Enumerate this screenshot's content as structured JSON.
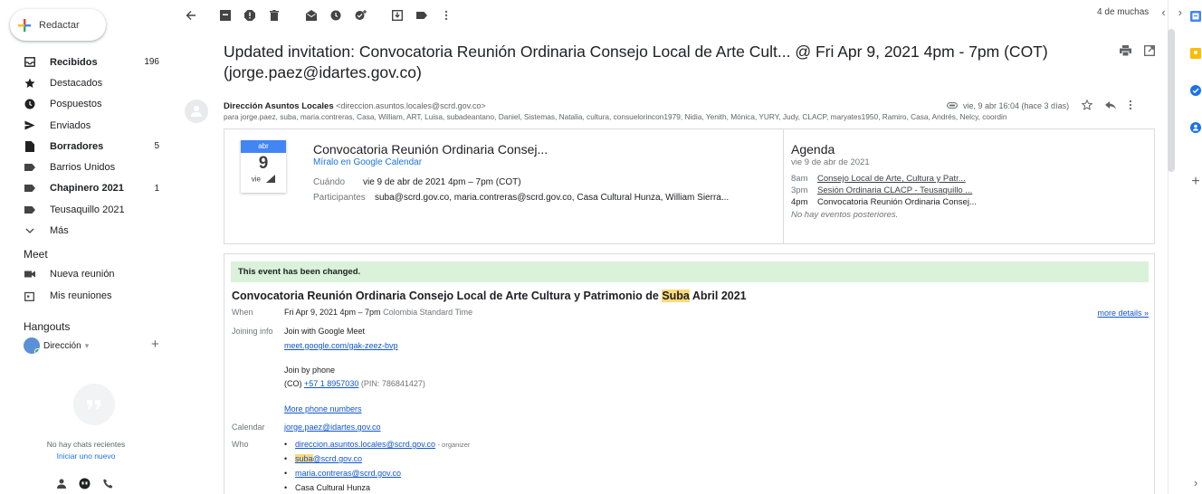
{
  "compose": {
    "label": "Redactar"
  },
  "nav": [
    {
      "label": "Recibidos",
      "count": "196",
      "bold": true,
      "icon": "inbox-icon"
    },
    {
      "label": "Destacados",
      "count": "",
      "bold": false,
      "icon": "star-icon"
    },
    {
      "label": "Pospuestos",
      "count": "",
      "bold": false,
      "icon": "clock-icon"
    },
    {
      "label": "Enviados",
      "count": "",
      "bold": false,
      "icon": "send-icon"
    },
    {
      "label": "Borradores",
      "count": "5",
      "bold": true,
      "icon": "draft-icon"
    },
    {
      "label": "Barrios Unidos",
      "count": "",
      "bold": false,
      "icon": "label-icon"
    },
    {
      "label": "Chapinero 2021",
      "count": "1",
      "bold": true,
      "icon": "label-icon"
    },
    {
      "label": "Teusaquillo 2021",
      "count": "",
      "bold": false,
      "icon": "label-icon"
    },
    {
      "label": "Más",
      "count": "",
      "bold": false,
      "icon": "chevron-down-icon"
    }
  ],
  "meet": {
    "title": "Meet",
    "new_meeting": "Nueva reunión",
    "my_meetings": "Mis reuniones"
  },
  "hangouts": {
    "title": "Hangouts",
    "user": "Dirección",
    "empty": "No hay chats recientes",
    "start": "Iniciar uno nuevo"
  },
  "pager": {
    "text": "4 de muchas"
  },
  "email": {
    "subject": "Updated invitation: Convocatoria Reunión Ordinaria Consejo Local de Arte Cult... @ Fri Apr 9, 2021 4pm - 7pm (COT) (jorge.paez@idartes.gov.co)",
    "sender_name": "Dirección Asuntos Locales",
    "sender_email": "<direccion.asuntos.locales@scrd.gov.co>",
    "date": "vie, 9 abr 16:04 (hace 3 días)",
    "to": "para jorge.paez, suba, maria.contreras, Casa, William, ART, Luisa, subadeantano, Daniel, Sistemas, Natalia, cultura, consuelorincon1979, Nidia, Yenith, Mónica, YURY, Judy, CLACP, maryates1950, Ramiro, Casa, Andrés, Nelcy, coordin"
  },
  "calendar_card": {
    "month": "abr",
    "day": "9",
    "dow": "vie",
    "title": "Convocatoria Reunión Ordinaria Consej...",
    "view_link": "Míralo en Google Calendar",
    "when_label": "Cuándo",
    "when_value": "vie 9 de abr de 2021 4pm – 7pm (COT)",
    "participants_label": "Participantes",
    "participants_value": "suba@scrd.gov.co, maria.contreras@scrd.gov.co, Casa Cultural Hunza, William Sierra..."
  },
  "agenda": {
    "title": "Agenda",
    "date": "vie 9 de abr de 2021",
    "items": [
      {
        "time": "8am",
        "event": "Consejo Local de Arte, Cultura y Patr..."
      },
      {
        "time": "3pm",
        "event": "Sesión Ordinaria CLACP - Teusaquillo ..."
      },
      {
        "time": "4pm",
        "event": "Convocatoria Reunión Ordinaria Consej..."
      }
    ],
    "none": "No hay eventos posteriores."
  },
  "details": {
    "changed": "This event has been changed.",
    "title_pre": "Convocatoria Reunión Ordinaria Consejo Local de Arte Cultura y Patrimonio de ",
    "title_hl": "Suba",
    "title_post": " Abril 2021",
    "when_label": "When",
    "when_value": "Fri Apr 9, 2021 4pm – 7pm",
    "when_tz": "Colombia Standard Time",
    "more": "more details »",
    "joining_label": "Joining info",
    "join_meet": "Join with Google Meet",
    "meet_link": "meet.google.com/gak-zeez-bvp",
    "join_phone": "Join by phone",
    "phone_prefix": "(CO)",
    "phone": "+57 1 8957030",
    "pin": "(PIN: 786841427)",
    "more_phones": "More phone numbers",
    "calendar_label": "Calendar",
    "calendar_value": "jorge.paez@idartes.gov.co",
    "who_label": "Who",
    "who": [
      {
        "name": "direccion.asuntos.locales@scrd.gov.co",
        "role": "- organizer"
      },
      {
        "hl": "suba",
        "name": "@scrd.gov.co"
      },
      {
        "name": "maria.contreras@scrd.gov.co"
      },
      {
        "name": "Casa Cultural Hunza"
      }
    ]
  }
}
